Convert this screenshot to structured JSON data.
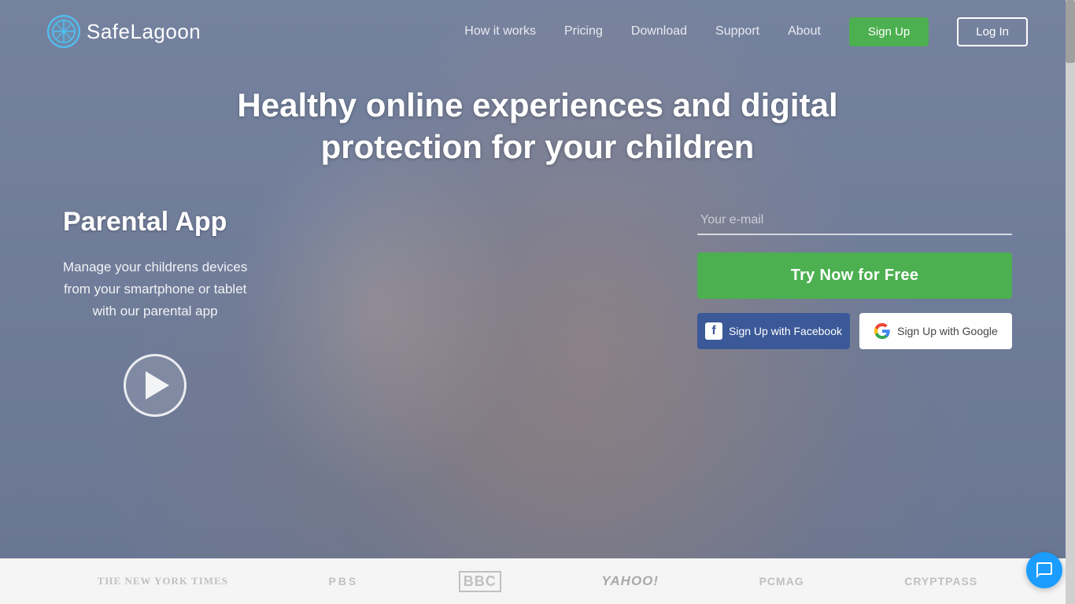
{
  "brand": {
    "name_part1": "Safe",
    "name_part2": "Lagoon"
  },
  "nav": {
    "how_it_works": "How it works",
    "pricing": "Pricing",
    "download": "Download",
    "support": "Support",
    "about": "About",
    "signup": "Sign Up",
    "login": "Log In"
  },
  "hero": {
    "headline": "Healthy online experiences and digital protection for your children",
    "left": {
      "title": "Parental App",
      "description": "Manage your childrens devices\nfrom your smartphone or tablet\nwith our parental app"
    },
    "form": {
      "email_placeholder": "Your e-mail",
      "cta_button": "Try Now for Free",
      "facebook_button": "Sign Up with Facebook",
      "google_button": "Sign Up with Google"
    }
  },
  "press_logos": [
    "The New York Times",
    "PBS",
    "BBC",
    "Yahoo!",
    "PCMag",
    "CryptPass"
  ],
  "colors": {
    "green": "#4CAF50",
    "facebook_blue": "#3b5998",
    "chat_blue": "#1a9dff"
  }
}
